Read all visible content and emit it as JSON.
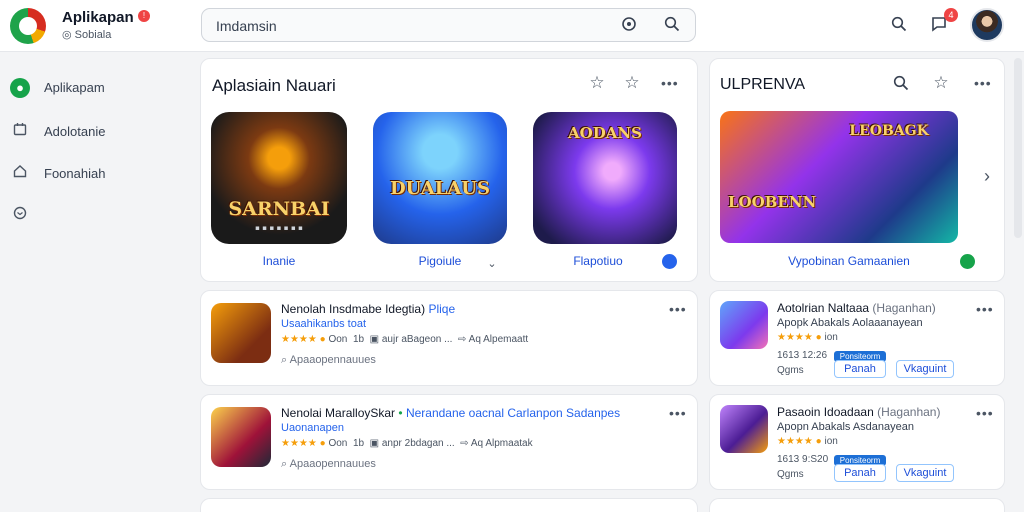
{
  "header": {
    "app_title": "Aplikapan",
    "app_badge": "!",
    "app_subtitle": "Sobiala",
    "search_value": "Imdamsin",
    "notif_count": "4"
  },
  "sidebar": {
    "items": [
      {
        "label": "Aplikapam",
        "icon": "android-icon"
      },
      {
        "label": "Adolotanie",
        "icon": "calendar-icon"
      },
      {
        "label": "Foonahiah",
        "icon": "home-icon"
      },
      {
        "label": "",
        "icon": "chat-icon"
      }
    ]
  },
  "featured": {
    "title": "Aplasiain Nauari",
    "tiles": [
      {
        "art": "SARNBAI",
        "sub": "▪ ▪ ▪ ▪ ▪ ▪ ▪",
        "caption": "Inanie"
      },
      {
        "art": "DUALAUS",
        "sub": "",
        "caption": "Pigoiule"
      },
      {
        "art": "AODANS",
        "sub": "",
        "caption": "Flapotiuo"
      }
    ]
  },
  "promo": {
    "title": "ULPRENVA",
    "art_top": "LEOBAGK",
    "art_bottom": "LOOBENN",
    "caption": "Vypobinan Gamaanien"
  },
  "list_main": [
    {
      "title": "Nenolah Insdmabe Idegtia)",
      "title_link": "Pliqe",
      "sub": "Usaahikanbs toat",
      "rating_num": "Oon",
      "size": "1b",
      "meta1": "aujr aBageon ...",
      "meta2": "Aq Alpemaatt",
      "footer": "Apaaopennauues"
    },
    {
      "title": "Nenolai MaralloySkar",
      "title_link": "Nerandane oacnal Carlanpon Sadanpes",
      "sub": "Uaonanapen",
      "rating_num": "Oon",
      "size": "1b",
      "meta1": "anpr 2bdagan ...",
      "meta2": "Aq Alpmaatak",
      "footer": "Apaaopennauues"
    }
  ],
  "list_side": [
    {
      "title": "Aotolrian Naltaaa",
      "title_extra": "(Haganhan)",
      "line2": "Apopk Abakals Aolaaanayean",
      "rating_num": "ion",
      "date": "1613 12:26",
      "date2": "Qgms",
      "pill1": "Ponsiteorm",
      "pill2": "Panah",
      "button": "Vkaguint"
    },
    {
      "title": "Pasaoin Idoadaan",
      "title_extra": "(Haganhan)",
      "line2": "Apopn Abakals Asdanayean",
      "rating_num": "ion",
      "date": "1613 9:S20",
      "date2": "Qgms",
      "pill1": "Ponsiteorm",
      "pill2": "Panah",
      "button": "Vkaguint"
    }
  ],
  "colors": {
    "accent": "#1d6fd6",
    "link": "#2563eb",
    "star": "#f59e0b",
    "badge": "#ef4444"
  }
}
